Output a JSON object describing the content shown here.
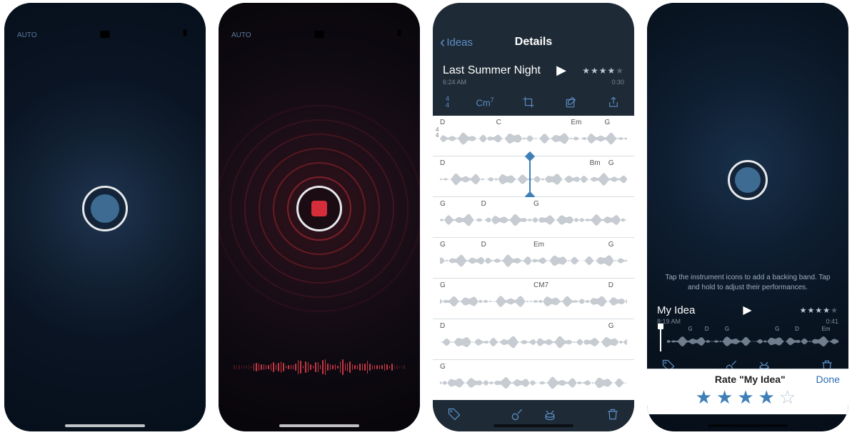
{
  "screen1": {
    "auto_label": "AUTO"
  },
  "screen2": {
    "auto_label": "AUTO"
  },
  "screen3": {
    "back_label": "Ideas",
    "nav_title": "Details",
    "track_title": "Last Summer Night",
    "timestamp": "6:24 AM",
    "duration": "0:30",
    "stars": 4,
    "stars_max": 5,
    "time_sig_top": "4",
    "time_sig_bot": "4",
    "key_chord": "Cm",
    "key_chord_ext": "7",
    "rows": [
      {
        "ts": true,
        "chords": [
          {
            "p": 0,
            "t": "D"
          },
          {
            "p": 30,
            "t": "C"
          },
          {
            "p": 70,
            "t": "Em"
          },
          {
            "p": 88,
            "t": "G"
          }
        ]
      },
      {
        "loop": true,
        "chords": [
          {
            "p": 0,
            "t": "D"
          },
          {
            "p": 80,
            "t": "Bm"
          },
          {
            "p": 90,
            "t": "G"
          }
        ]
      },
      {
        "chords": [
          {
            "p": 0,
            "t": "G"
          },
          {
            "p": 22,
            "t": "D"
          },
          {
            "p": 50,
            "t": "G"
          }
        ]
      },
      {
        "chords": [
          {
            "p": 0,
            "t": "G"
          },
          {
            "p": 22,
            "t": "D"
          },
          {
            "p": 50,
            "t": "Em"
          },
          {
            "p": 90,
            "t": "G"
          }
        ]
      },
      {
        "chords": [
          {
            "p": 0,
            "t": "G"
          },
          {
            "p": 50,
            "t": "CM7"
          },
          {
            "p": 90,
            "t": "D"
          }
        ]
      },
      {
        "chords": [
          {
            "p": 0,
            "t": "D"
          },
          {
            "p": 90,
            "t": "G"
          }
        ]
      },
      {
        "chords": [
          {
            "p": 0,
            "t": "G"
          }
        ]
      }
    ]
  },
  "screen4": {
    "hint": "Tap the instrument icons to add a backing band. Tap and hold to adjust their performances.",
    "track_title": "My Idea",
    "timestamp": "8:19 AM",
    "duration": "0:41",
    "stars": 4,
    "stars_max": 5,
    "wave_chords": [
      {
        "p": 10,
        "t": "G"
      },
      {
        "p": 20,
        "t": "D"
      },
      {
        "p": 32,
        "t": "G"
      },
      {
        "p": 62,
        "t": "G"
      },
      {
        "p": 74,
        "t": "D"
      },
      {
        "p": 90,
        "t": "Em"
      }
    ],
    "rate_title": "Rate \"My Idea\"",
    "done_label": "Done",
    "rating": 4,
    "rating_max": 5
  }
}
